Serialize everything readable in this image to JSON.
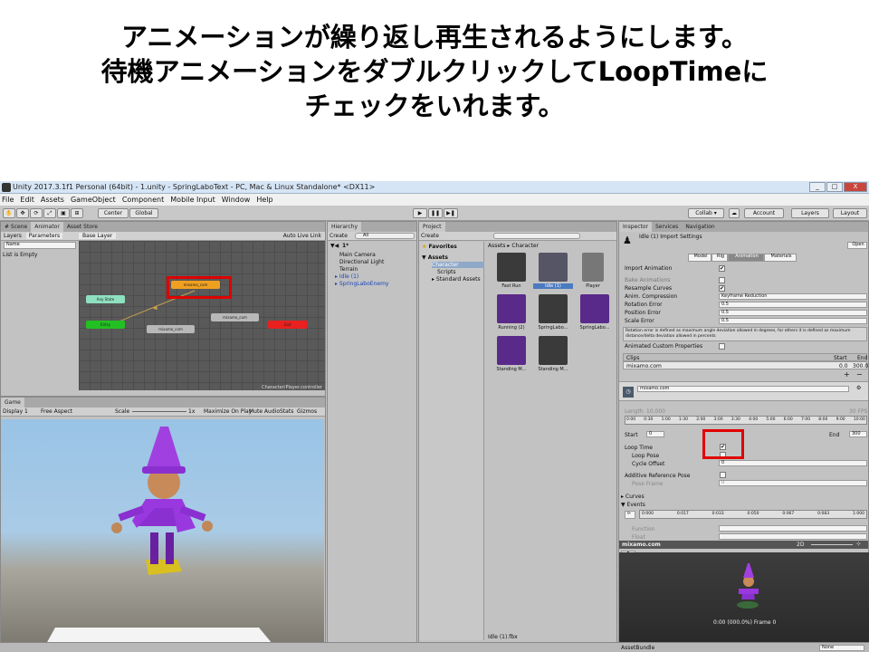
{
  "caption": {
    "line1": "アニメーションが繰り返し再生されるようにします。",
    "line2": "待機アニメーションをダブルクリックしてLoopTimeに",
    "line3": "チェックをいれます。"
  },
  "window": {
    "title": "Unity 2017.3.1f1 Personal (64bit) - 1.unity - SpringLaboText - PC, Mac & Linux Standalone* <DX11>",
    "minimize": "_",
    "maximize": "□",
    "close": "X"
  },
  "menu": [
    "File",
    "Edit",
    "Assets",
    "GameObject",
    "Component",
    "Mobile Input",
    "Window",
    "Help"
  ],
  "toolbar": {
    "center": "Center",
    "global": "Global",
    "collab": "Collab ▾",
    "account": "Account",
    "layers": "Layers",
    "layout": "Layout"
  },
  "animator": {
    "tabs": [
      "# Scene",
      "Animator",
      "Asset Store"
    ],
    "layers_tab": "Layers",
    "parameters_tab": "Parameters",
    "base_layer": "Base Layer",
    "auto_live_link": "Auto Live Link",
    "list_empty": "List is Empty",
    "search_placeholder": "Name",
    "footer_path": "Character/Player.controller",
    "states": {
      "highlight": "mixamo_com",
      "any_state": "Any State",
      "entry": "Entry",
      "s1": "mixamo_com",
      "s2": "mixamo_com",
      "exit": "Exit"
    }
  },
  "game": {
    "tab": "Game",
    "display": "Display 1",
    "aspect": "Free Aspect",
    "scale_label": "Scale",
    "scale_value": "1x",
    "maximize": "Maximize On Play",
    "mute": "Mute Audio",
    "stats": "Stats",
    "gizmos": "Gizmos"
  },
  "hierarchy": {
    "tab": "Hierarchy",
    "create": "Create",
    "search_placeholder": "All",
    "scene": "1*",
    "items": [
      "Main Camera",
      "Directional Light",
      "Terrain",
      "Idle (1)",
      "SpringLaboEnemy"
    ]
  },
  "project": {
    "tab": "Project",
    "create": "Create",
    "favorites": "Favorites",
    "assets": "Assets",
    "tree": [
      "Character",
      "Scripts",
      "Standard Assets"
    ],
    "breadcrumb": "Assets ▸ Character",
    "items": [
      "Fast Run",
      "Idle (1)",
      "Player",
      "Running (2)",
      "SpringLabo...",
      "SpringLabo...",
      "Standing M...",
      "Standing M..."
    ],
    "footer": "Idle (1).fbx"
  },
  "inspector": {
    "tabs": [
      "Inspector",
      "Services",
      "Navigation"
    ],
    "title": "Idle (1) Import Settings",
    "open": "Open",
    "subtabs": [
      "Model",
      "Rig",
      "Animation",
      "Materials"
    ],
    "import_animation": "Import Animation",
    "bake_animations": "Bake Animations",
    "resample_curves": "Resample Curves",
    "anim_compression": "Anim. Compression",
    "anim_compression_value": "Keyframe Reduction",
    "rotation_error": "Rotation Error",
    "rotation_error_value": "0.5",
    "position_error": "Position Error",
    "position_error_value": "0.5",
    "scale_error": "Scale Error",
    "scale_error_value": "0.5",
    "help": "Rotation error is defined as maximum angle deviation allowed in degrees, for others it is defined as maximum distance/delta deviation allowed in percents",
    "animated_custom": "Animated Custom Properties",
    "clips": "Clips",
    "start": "Start",
    "end": "End",
    "clip_name": "mixamo.com",
    "clip_start": "0.0",
    "clip_end": "300.0",
    "clip_field": "mixamo.com",
    "length_label": "Length",
    "length_value": "10.000",
    "fps": "30 FPS",
    "timeline": [
      "0:00",
      "0:30",
      "1:00",
      "1:30",
      "2:00",
      "3:00",
      "3:30",
      "4:00",
      "5:00",
      "6:00",
      "7:00",
      "8:00",
      "9:00",
      "10:00"
    ],
    "start_value": "0",
    "end_value": "300",
    "loop_time": "Loop Time",
    "loop_pose": "Loop Pose",
    "cycle_offset": "Cycle Offset",
    "cycle_offset_value": "0",
    "additive": "Additive Reference Pose",
    "pose_frame": "Pose Frame",
    "pose_frame_value": "0",
    "curves": "Curves",
    "events": "Events",
    "event_ticks": [
      "0:000",
      "0:017",
      "0:033",
      "0:050",
      "0:067",
      "0:083",
      "1:000"
    ],
    "function_label": "Function",
    "float_label": "Float",
    "preview_title": "mixamo.com",
    "preview_speed": "2D",
    "preview_frame": "0:00 (000.0%) Frame 0",
    "assetbundle": "AssetBundle",
    "assetbundle_value": "None"
  }
}
